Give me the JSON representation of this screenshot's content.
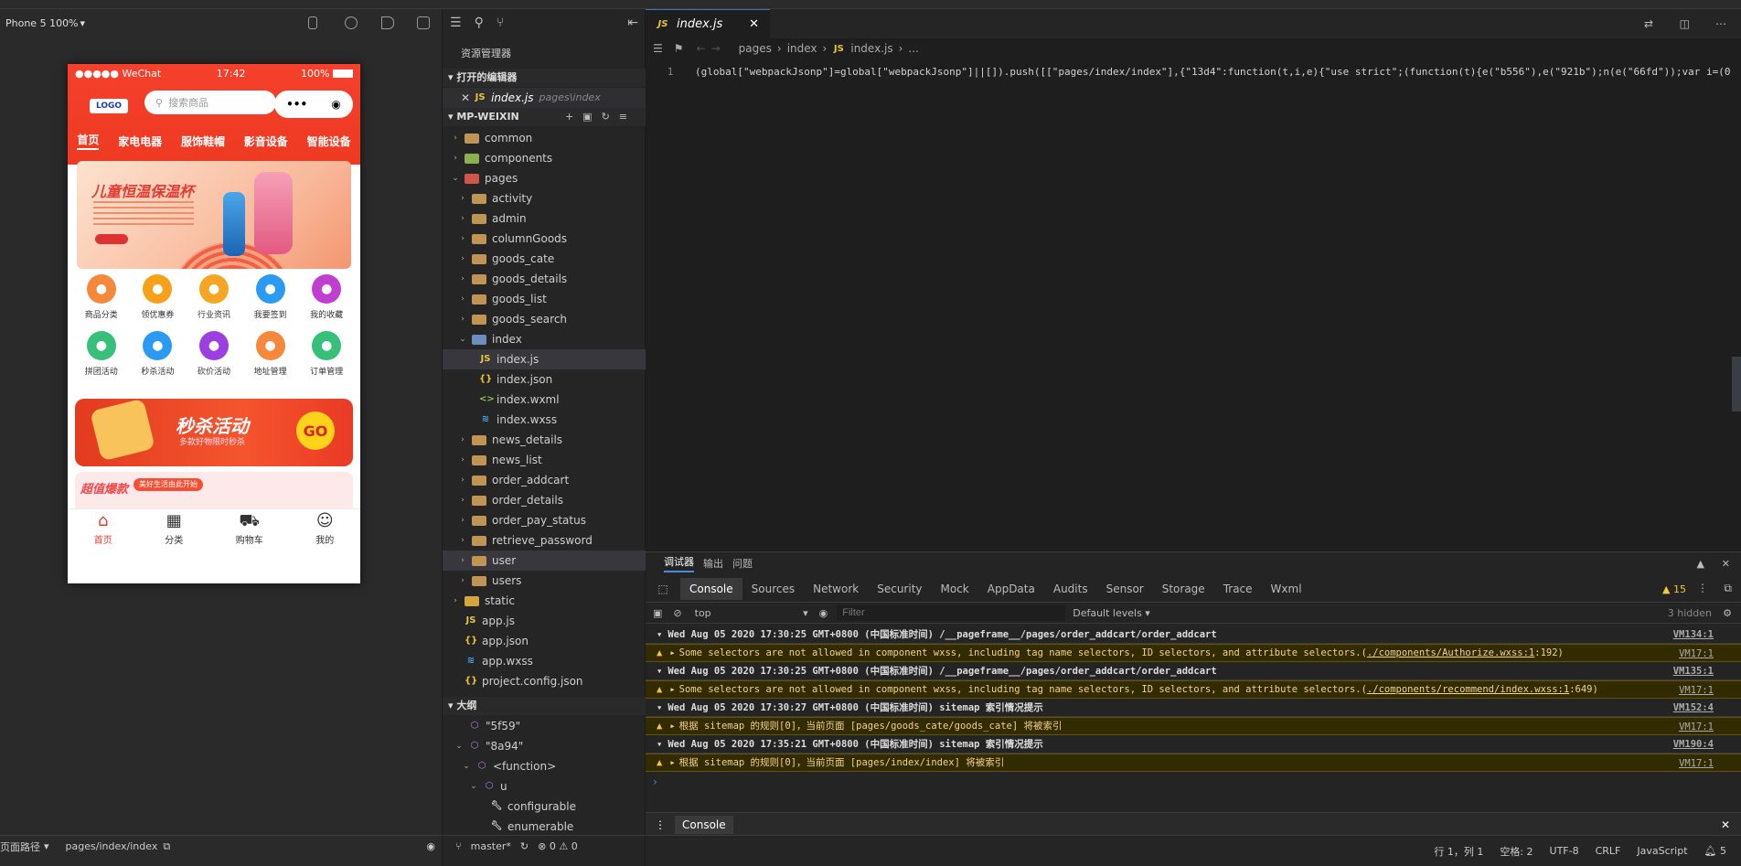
{
  "simulator": {
    "device": "Phone 5 100%",
    "device_caret": "▾"
  },
  "phone": {
    "status_left": "●●●●● WeChat",
    "status_time": "17:42",
    "status_right": "100%",
    "logo": "LOGO",
    "search_placeholder": "搜索商品",
    "nav": [
      "首页",
      "家电电器",
      "服饰鞋帽",
      "影音设备",
      "智能设备"
    ],
    "banner_title": "儿童恒温保温杯",
    "icons_row1": [
      {
        "label": "商品分类",
        "color": "#f5883a",
        "icon": "box-icon"
      },
      {
        "label": "领优惠券",
        "color": "#f7a11b",
        "icon": "coupon-icon"
      },
      {
        "label": "行业资讯",
        "color": "#f5a623",
        "icon": "news-icon"
      },
      {
        "label": "我要签到",
        "color": "#2b9af3",
        "icon": "pen-icon"
      },
      {
        "label": "我的收藏",
        "color": "#c13fd0",
        "icon": "bookmark-icon"
      }
    ],
    "icons_row2": [
      {
        "label": "拼团活动",
        "color": "#37c07a",
        "icon": "crown-icon"
      },
      {
        "label": "秒杀活动",
        "color": "#2b9af3",
        "icon": "flash-icon"
      },
      {
        "label": "砍价活动",
        "color": "#9b3fe0",
        "icon": "tag-icon"
      },
      {
        "label": "地址管理",
        "color": "#f5883a",
        "icon": "location-icon"
      },
      {
        "label": "订单管理",
        "color": "#37c07a",
        "icon": "chat-icon"
      }
    ],
    "seckill_title": "秒杀活动",
    "seckill_sub": "多款好物限时秒杀",
    "seckill_go": "GO",
    "hot_title": "超值爆款",
    "hot_tag": "美好生活由此开始",
    "tabbar": [
      "首页",
      "分类",
      "购物车",
      "我的"
    ]
  },
  "sim_footer": {
    "label": "页面路径",
    "path": "pages/index/index"
  },
  "explorer": {
    "title": "资源管理器",
    "open_editors": "打开的编辑器",
    "open_file": "index.js",
    "open_file_path": "pages\\index",
    "project": "MP-WEIXIN",
    "tree": [
      {
        "name": "common",
        "depth": 1,
        "kind": "folder",
        "arrow": "›"
      },
      {
        "name": "components",
        "depth": 1,
        "kind": "folder-green",
        "arrow": "›"
      },
      {
        "name": "pages",
        "depth": 1,
        "kind": "folder-red",
        "arrow": "⌄"
      },
      {
        "name": "activity",
        "depth": 2,
        "kind": "folder",
        "arrow": "›"
      },
      {
        "name": "admin",
        "depth": 2,
        "kind": "folder",
        "arrow": "›"
      },
      {
        "name": "columnGoods",
        "depth": 2,
        "kind": "folder",
        "arrow": "›"
      },
      {
        "name": "goods_cate",
        "depth": 2,
        "kind": "folder",
        "arrow": "›"
      },
      {
        "name": "goods_details",
        "depth": 2,
        "kind": "folder",
        "arrow": "›"
      },
      {
        "name": "goods_list",
        "depth": 2,
        "kind": "folder",
        "arrow": "›"
      },
      {
        "name": "goods_search",
        "depth": 2,
        "kind": "folder",
        "arrow": "›"
      },
      {
        "name": "index",
        "depth": 2,
        "kind": "folder-open",
        "arrow": "⌄"
      },
      {
        "name": "index.js",
        "depth": 3,
        "kind": "js",
        "arrow": ""
      },
      {
        "name": "index.json",
        "depth": 3,
        "kind": "json",
        "arrow": ""
      },
      {
        "name": "index.wxml",
        "depth": 3,
        "kind": "wxml",
        "arrow": ""
      },
      {
        "name": "index.wxss",
        "depth": 3,
        "kind": "wxss",
        "arrow": ""
      },
      {
        "name": "news_details",
        "depth": 2,
        "kind": "folder",
        "arrow": "›"
      },
      {
        "name": "news_list",
        "depth": 2,
        "kind": "folder",
        "arrow": "›"
      },
      {
        "name": "order_addcart",
        "depth": 2,
        "kind": "folder",
        "arrow": "›"
      },
      {
        "name": "order_details",
        "depth": 2,
        "kind": "folder",
        "arrow": "›"
      },
      {
        "name": "order_pay_status",
        "depth": 2,
        "kind": "folder",
        "arrow": "›"
      },
      {
        "name": "retrieve_password",
        "depth": 2,
        "kind": "folder",
        "arrow": "›"
      },
      {
        "name": "user",
        "depth": 2,
        "kind": "folder",
        "arrow": "›"
      },
      {
        "name": "users",
        "depth": 2,
        "kind": "folder",
        "arrow": "›"
      },
      {
        "name": "static",
        "depth": 1,
        "kind": "folder-gold",
        "arrow": "›"
      },
      {
        "name": "app.js",
        "depth": 1,
        "kind": "js",
        "arrow": ""
      },
      {
        "name": "app.json",
        "depth": 1,
        "kind": "json",
        "arrow": ""
      },
      {
        "name": "app.wxss",
        "depth": 1,
        "kind": "wxss",
        "arrow": ""
      },
      {
        "name": "project.config.json",
        "depth": 1,
        "kind": "json",
        "arrow": ""
      }
    ],
    "outline_title": "大纲",
    "outline": [
      {
        "name": "\"5f59\"",
        "depth": 1,
        "arrow": "",
        "kind": "cube"
      },
      {
        "name": "\"8a94\"",
        "depth": 1,
        "arrow": "⌄",
        "kind": "cube"
      },
      {
        "name": "<function>",
        "depth": 2,
        "arrow": "⌄",
        "kind": "cube"
      },
      {
        "name": "u",
        "depth": 3,
        "arrow": "⌄",
        "kind": "cube"
      },
      {
        "name": "configurable",
        "depth": 4,
        "arrow": "",
        "kind": "wrench"
      },
      {
        "name": "enumerable",
        "depth": 4,
        "arrow": "",
        "kind": "wrench"
      }
    ],
    "branch": "master*",
    "problems": "⊗ 0 ⚠ 0"
  },
  "editor": {
    "tab": "index.js",
    "breadcrumb": [
      "pages",
      "index",
      "index.js",
      "..."
    ],
    "line_no": "1",
    "code": "(global[\"webpackJsonp\"]=global[\"webpackJsonp\"]||[]).push([[\"pages/index/index\"],{\"13d4\":function(t,i,e){\"use strict\";(function(t){e(\"b556\"),e(\"921b\");n(e(\"66fd\"));var i=(0"
  },
  "devtools": {
    "top_tabs": [
      "调试器",
      "输出",
      "问题"
    ],
    "tabs": [
      "Console",
      "Sources",
      "Network",
      "Security",
      "Mock",
      "AppData",
      "Audits",
      "Sensor",
      "Storage",
      "Trace",
      "Wxml"
    ],
    "warn_count": "15",
    "context": "top",
    "filter_placeholder": "Filter",
    "levels": "Default levels",
    "hidden": "3 hidden",
    "logs": [
      {
        "type": "head",
        "text": "Wed Aug 05 2020 17:30:25 GMT+0800 (中国标准时间) /__pageframe__/pages/order_addcart/order_addcart",
        "src": "VM134:1"
      },
      {
        "type": "warn",
        "text": "Some selectors are not allowed in component wxss, including tag name selectors, ID selectors, and attribute selectors.(",
        "link": "./components/Authorize.wxss:1",
        "tail": ":192)",
        "src": "VM17:1"
      },
      {
        "type": "head",
        "text": "Wed Aug 05 2020 17:30:25 GMT+0800 (中国标准时间) /__pageframe__/pages/order_addcart/order_addcart",
        "src": "VM135:1"
      },
      {
        "type": "warn",
        "text": "Some selectors are not allowed in component wxss, including tag name selectors, ID selectors, and attribute selectors.(",
        "link": "./components/recommend/index.wxss:1",
        "tail": ":649)",
        "src": "VM17:1"
      },
      {
        "type": "head",
        "text": "Wed Aug 05 2020 17:30:27 GMT+0800 (中国标准时间) sitemap 索引情况提示",
        "src": "VM152:4"
      },
      {
        "type": "warn",
        "text": " 根据 sitemap 的规则[0]，当前页面 [pages/goods_cate/goods_cate] 将被索引",
        "link": "",
        "tail": "",
        "src": "VM17:1"
      },
      {
        "type": "head",
        "text": "Wed Aug 05 2020 17:35:21 GMT+0800 (中国标准时间) sitemap 索引情况提示",
        "src": "VM190:4"
      },
      {
        "type": "warn",
        "text": " 根据 sitemap 的规则[0]，当前页面 [pages/index/index] 将被索引",
        "link": "",
        "tail": "",
        "src": "VM17:1"
      }
    ],
    "console_drawer": "Console"
  },
  "status": {
    "pos": "行 1，列 1",
    "indent": "空格: 2",
    "encoding": "UTF-8",
    "eol": "CRLF",
    "lang": "JavaScript",
    "bell": "5"
  }
}
